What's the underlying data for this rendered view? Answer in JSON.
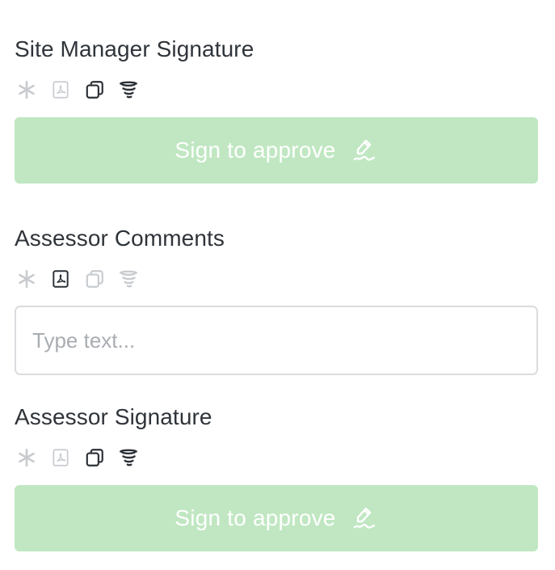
{
  "fields": [
    {
      "label": "Site Manager Signature",
      "icons": [
        "required-asterisk-icon",
        "pdf-icon",
        "copy-icon",
        "tornado-icon"
      ],
      "button_label": "Sign to approve"
    },
    {
      "label": "Assessor Comments",
      "icons": [
        "required-asterisk-icon",
        "pdf-icon",
        "copy-icon",
        "tornado-icon"
      ],
      "placeholder": "Type text...",
      "value": ""
    },
    {
      "label": "Assessor Signature",
      "icons": [
        "required-asterisk-icon",
        "pdf-icon",
        "copy-icon",
        "tornado-icon"
      ],
      "button_label": "Sign to approve"
    }
  ],
  "colors": {
    "button_bg": "#c0e7c2",
    "button_text": "#ffffff",
    "icon_active": "#2b3036",
    "icon_inactive": "#c8cbcf",
    "input_border": "#dadcdf",
    "placeholder": "#a9adb2"
  }
}
